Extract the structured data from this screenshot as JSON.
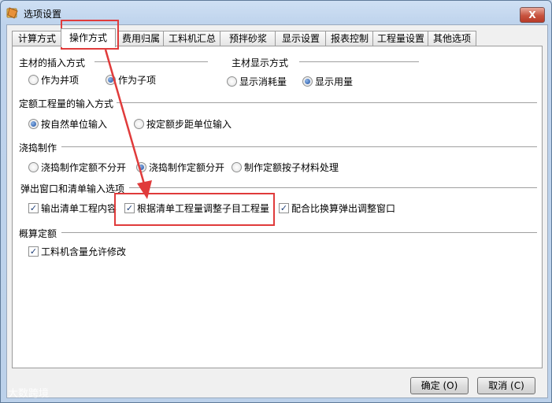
{
  "window": {
    "title": "选项设置",
    "close_glyph": "X"
  },
  "tabs": [
    {
      "label": "计算方式",
      "active": false
    },
    {
      "label": "操作方式",
      "active": true
    },
    {
      "label": "费用归属",
      "active": false
    },
    {
      "label": "工料机汇总",
      "active": false
    },
    {
      "label": "预拌砂浆",
      "active": false
    },
    {
      "label": "显示设置",
      "active": false
    },
    {
      "label": "报表控制",
      "active": false
    },
    {
      "label": "工程量设置",
      "active": false
    },
    {
      "label": "其他选项",
      "active": false
    }
  ],
  "sections": {
    "main_insert": {
      "title": "主材的插入方式",
      "options": [
        "作为并项",
        "作为子项"
      ],
      "selected": "作为子项"
    },
    "main_display": {
      "title": "主材显示方式",
      "options": [
        "显示消耗量",
        "显示用量"
      ],
      "selected": "显示用量"
    },
    "quota_input": {
      "title": "定额工程量的输入方式",
      "options": [
        "按自然单位输入",
        "按定额步距单位输入"
      ],
      "selected": "按自然单位输入"
    },
    "pour": {
      "title": "浇捣制作",
      "options": [
        "浇捣制作定额不分开",
        "浇捣制作定额分开",
        "制作定额按子材料处理"
      ],
      "selected": "浇捣制作定额分开"
    },
    "popup": {
      "title": "弹出窗口和清单输入选项",
      "checks": [
        {
          "label": "输出清单工程内容",
          "checked": true
        },
        {
          "label": "根据清单工程量调整子目工程量",
          "checked": true
        },
        {
          "label": "配合比换算弹出调整窗口",
          "checked": true
        }
      ]
    },
    "estimate": {
      "title": "概算定额",
      "checks": [
        {
          "label": "工料机含量允许修改",
          "checked": true
        }
      ]
    }
  },
  "buttons": {
    "ok": "确定 (O)",
    "cancel": "取消 (C)"
  },
  "check_glyph": "✓",
  "annotation_color": "#e03b3b",
  "watermark": "大数跨境"
}
